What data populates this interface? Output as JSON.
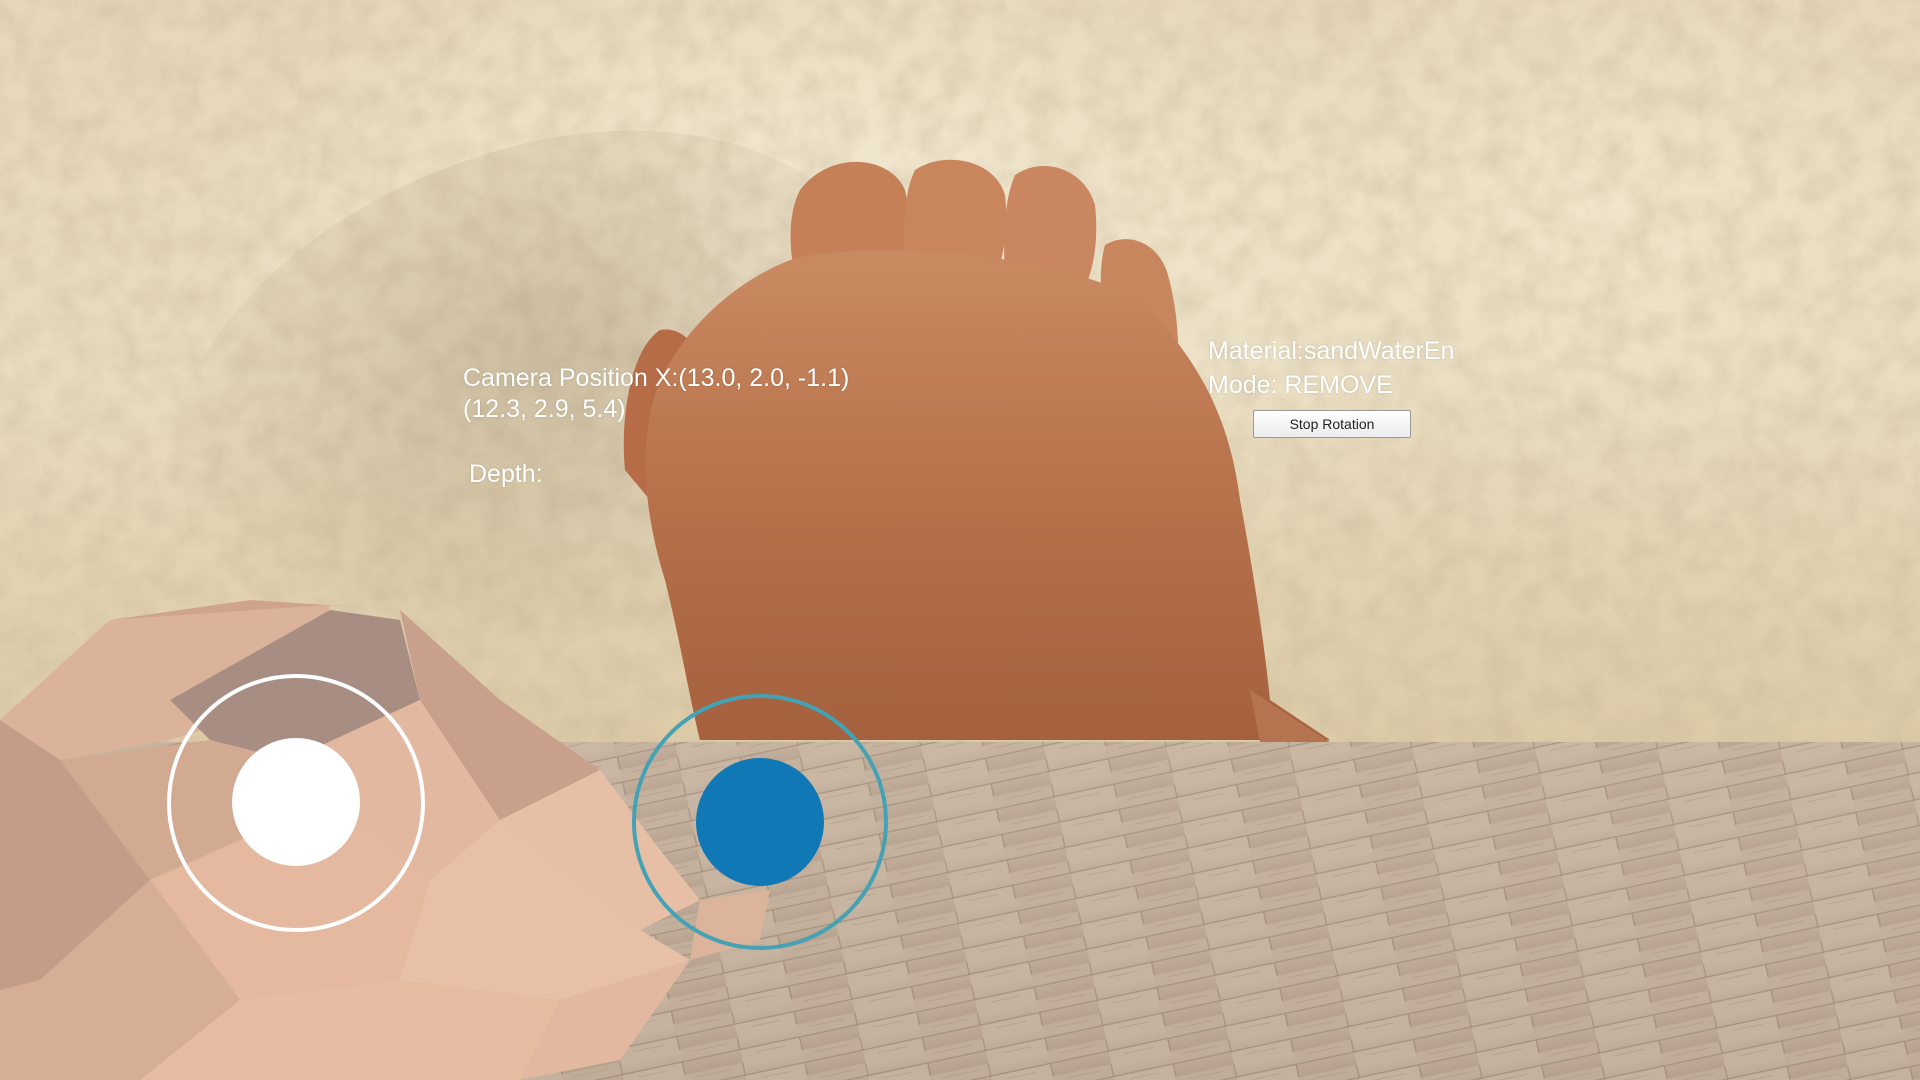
{
  "hud": {
    "camera_position_text": "Camera Position X:(13.0, 2.0, -1.1)",
    "camera_vector_text": "(12.3, 2.9, 5.4)",
    "depth_text": "Depth:",
    "material_text": "Material:sandWaterEn",
    "mode_text": "Mode: REMOVE",
    "stop_rotation_label": "Stop Rotation"
  },
  "joysticks": {
    "left": {
      "ring_color": "#ffffff",
      "knob_color": "#ffffff"
    },
    "right": {
      "ring_color": "#45a2b5",
      "knob_color": "#1078b5"
    }
  },
  "icons": {
    "left_joystick": "joystick-icon",
    "right_joystick": "joystick-icon"
  }
}
